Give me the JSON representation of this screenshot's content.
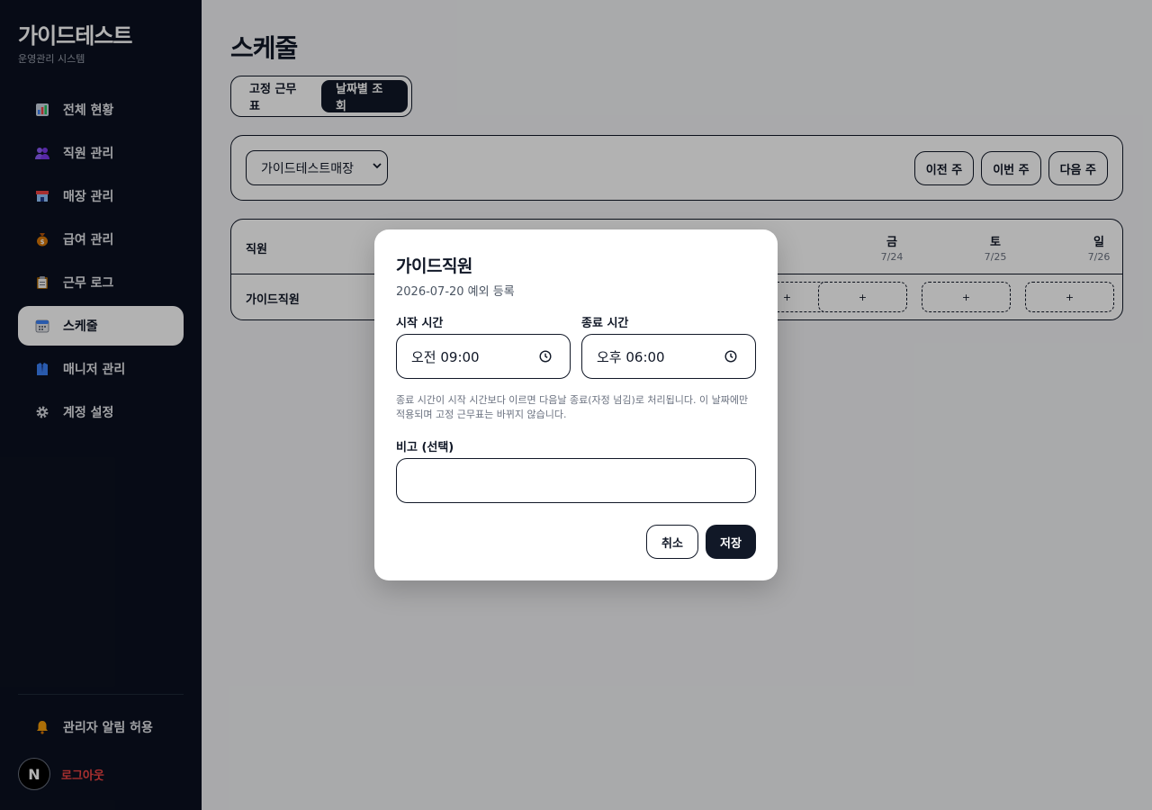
{
  "brand": {
    "title": "가이드테스트",
    "subtitle": "운영관리 시스템"
  },
  "sidebar": {
    "items": [
      {
        "label": "전체 현황",
        "icon": "chart-icon"
      },
      {
        "label": "직원 관리",
        "icon": "people-icon"
      },
      {
        "label": "매장 관리",
        "icon": "store-icon"
      },
      {
        "label": "급여 관리",
        "icon": "money-bag-icon"
      },
      {
        "label": "근무 로그",
        "icon": "clipboard-icon"
      },
      {
        "label": "스케줄",
        "icon": "calendar-icon",
        "active": true
      },
      {
        "label": "매니저 관리",
        "icon": "manager-icon"
      },
      {
        "label": "계정 설정",
        "icon": "gear-icon"
      }
    ],
    "notify_label": "관리자 알림 허용",
    "avatar_letter": "N",
    "logout_label": "로그아웃"
  },
  "main": {
    "title": "스케줄",
    "toggle": {
      "fixed_label": "고정 근무표",
      "daily_label": "날짜별 조회"
    },
    "store_select": "가이드테스트매장",
    "week_buttons": {
      "prev": "이전 주",
      "this": "이번 주",
      "next": "다음 주"
    },
    "table": {
      "employee_header": "직원",
      "days": [
        {
          "name": "금",
          "date": "7/24"
        },
        {
          "name": "토",
          "date": "7/25"
        },
        {
          "name": "일",
          "date": "7/26"
        }
      ],
      "rows": [
        {
          "name": "가이드직원",
          "add_label": "+"
        }
      ]
    }
  },
  "modal": {
    "title": "가이드직원",
    "subtitle": "2026-07-20 예외 등록",
    "start_label": "시작 시간",
    "start_value": "오전 09:00",
    "end_label": "종료 시간",
    "end_value": "오후 06:00",
    "hint": "종료 시간이 시작 시간보다 이르면 다음날 종료(자정 넘김)로 처리됩니다. 이 날짜에만 적용되며 고정 근무표는 바뀌지 않습니다.",
    "memo_label": "비고 (선택)",
    "memo_value": "",
    "cancel_label": "취소",
    "save_label": "저장"
  },
  "colors": {
    "sidebar_bg": "#0b1120",
    "accent": "#111827",
    "logout": "#ef4444"
  }
}
